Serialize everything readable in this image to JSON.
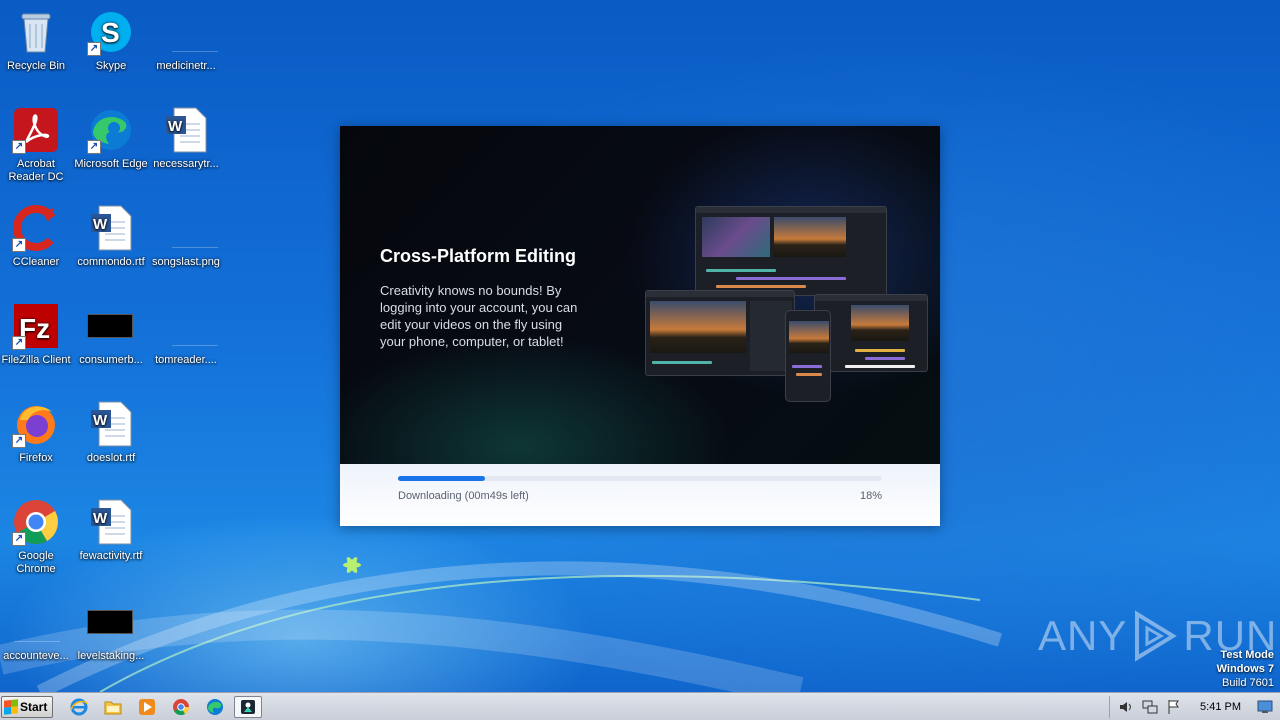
{
  "desktop": {
    "icons": [
      {
        "label": "Recycle Bin"
      },
      {
        "label": "Skype"
      },
      {
        "label": "medicinetr..."
      },
      {
        "label": "Acrobat Reader DC"
      },
      {
        "label": "Microsoft Edge"
      },
      {
        "label": "necessarytr..."
      },
      {
        "label": "CCleaner"
      },
      {
        "label": "commondo.rtf"
      },
      {
        "label": "songslast.png"
      },
      {
        "label": "FileZilla Client"
      },
      {
        "label": "consumerb..."
      },
      {
        "label": "tomreader...."
      },
      {
        "label": "Firefox"
      },
      {
        "label": "doeslot.rtf"
      },
      {
        "label": "Google Chrome"
      },
      {
        "label": "fewactivity.rtf"
      },
      {
        "label": "accounteve..."
      },
      {
        "label": "levelstaking..."
      }
    ]
  },
  "installer": {
    "headline": "Cross-Platform Editing",
    "description": "Creativity knows no bounds! By logging into your account, you can edit your videos on the fly using your phone, computer, or tablet!",
    "status": "Downloading (00m49s left)",
    "percent_label": "18%",
    "progress": 0.18
  },
  "watermark": {
    "left": "ANY",
    "right": "RUN",
    "test_mode": "Test Mode",
    "os": "Windows 7",
    "build": "Build 7601"
  },
  "taskbar": {
    "start_label": "Start",
    "clock": "5:41 PM",
    "pinned": [
      "internet-explorer-icon",
      "file-explorer-icon",
      "media-player-icon",
      "chrome-icon",
      "edge-icon",
      "installer-app-icon"
    ],
    "tray": [
      "volume-icon",
      "network-icon",
      "action-center-flag-icon",
      "show-desktop-icon"
    ]
  },
  "colors": {
    "progress_fill": "#1a73e8",
    "desktop_blue": "#1370d8"
  }
}
